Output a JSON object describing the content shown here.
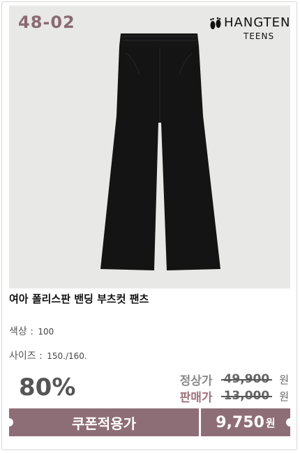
{
  "product": {
    "code": "48-02",
    "brand": {
      "name": "HANGTEN",
      "sub": "TEENS"
    },
    "title": "여아 폴리스판 밴딩 부츠컷 팬츠",
    "color_label": "색상 :",
    "color_value": "100",
    "size_label": "사이즈 :",
    "size_value": "150./160."
  },
  "pricing": {
    "discount": "80%",
    "regular_label": "정상가",
    "regular_price": "49,900",
    "sale_label": "판매가",
    "sale_price": "13,000",
    "unit": "원",
    "coupon_label": "쿠폰적용가",
    "final_price": "9,750",
    "final_unit": "원"
  },
  "colors": {
    "accent": "#8e6e76",
    "code_color": "#8a6b72",
    "sale_label_color": "#a0737d",
    "photo_bg": "#e8e8e6"
  }
}
